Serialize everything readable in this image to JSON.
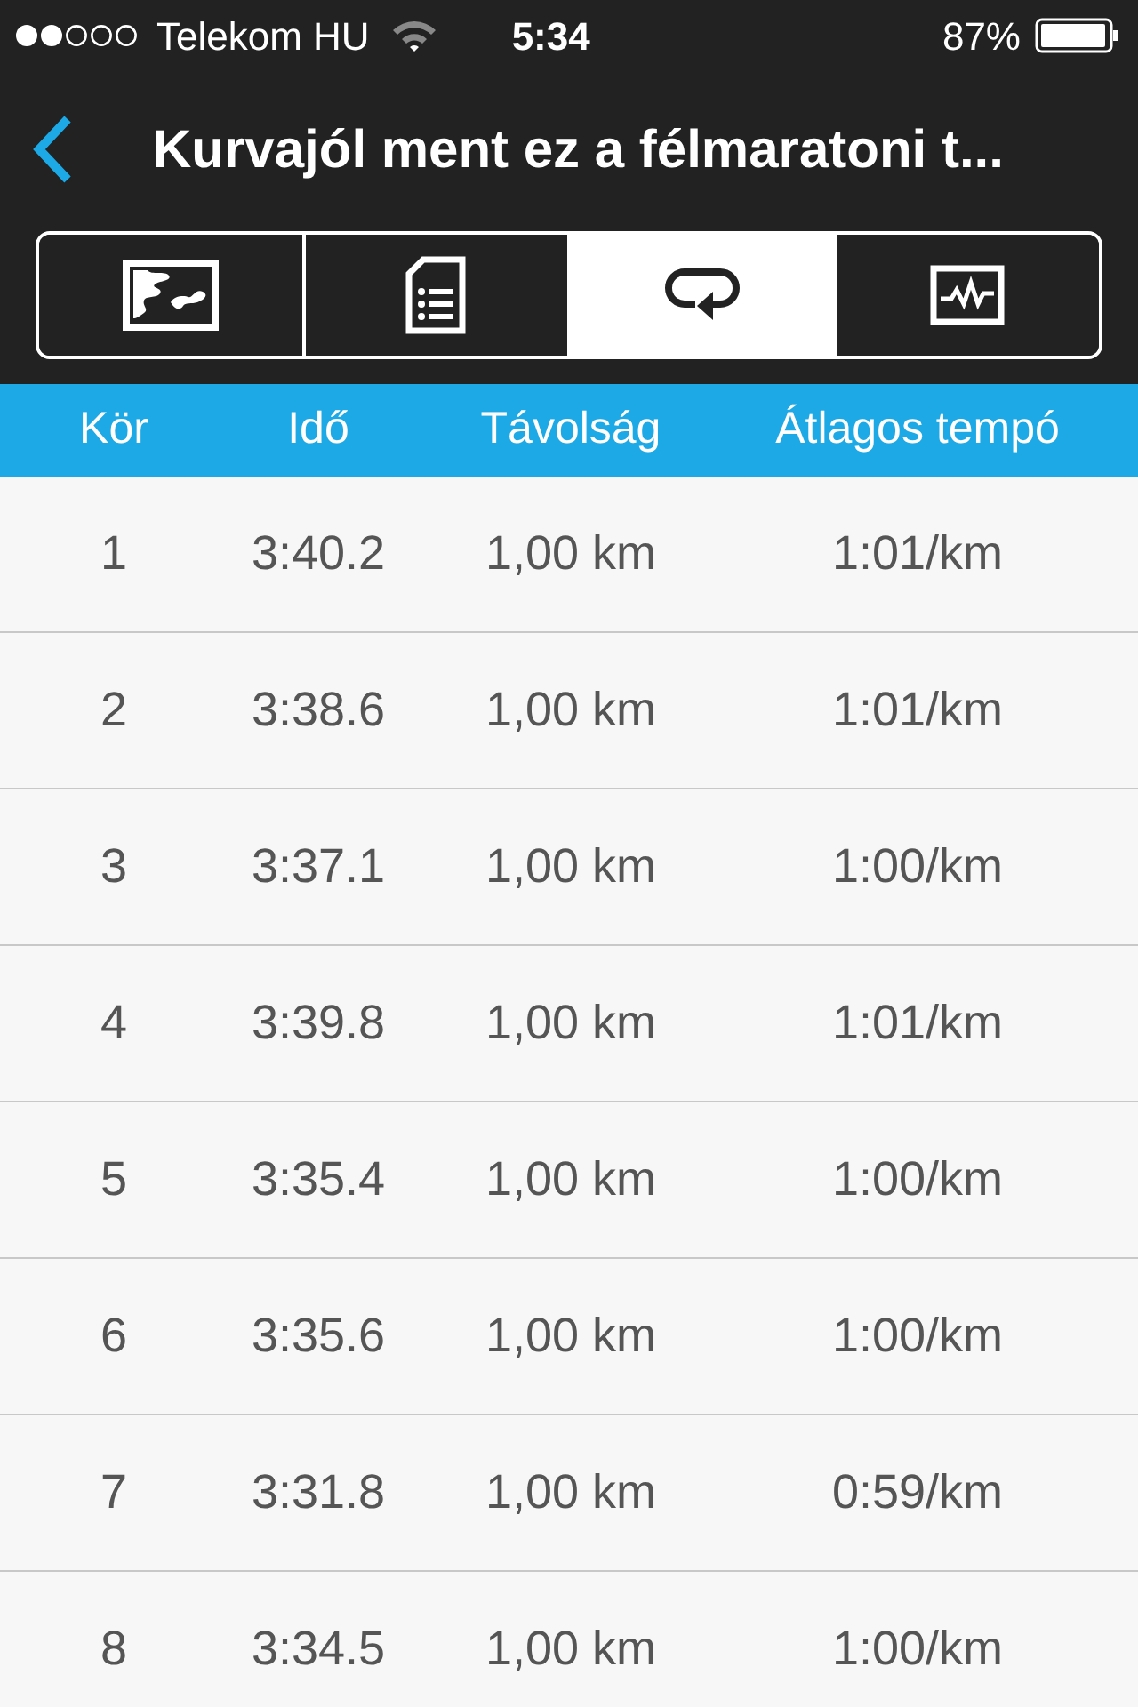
{
  "status_bar": {
    "carrier": "Telekom HU",
    "time": "5:34",
    "battery": "87%"
  },
  "header": {
    "title": "Kurvajól ment ez a félmaratoni t..."
  },
  "tabs": [
    {
      "kind": "map",
      "selected": false
    },
    {
      "kind": "details",
      "selected": false
    },
    {
      "kind": "laps",
      "selected": true
    },
    {
      "kind": "chart",
      "selected": false
    }
  ],
  "table": {
    "columns": [
      "Kör",
      "Idő",
      "Távolság",
      "Átlagos tempó"
    ],
    "rows": [
      [
        "1",
        "3:40.2",
        "1,00 km",
        "1:01/km"
      ],
      [
        "2",
        "3:38.6",
        "1,00 km",
        "1:01/km"
      ],
      [
        "3",
        "3:37.1",
        "1,00 km",
        "1:00/km"
      ],
      [
        "4",
        "3:39.8",
        "1,00 km",
        "1:01/km"
      ],
      [
        "5",
        "3:35.4",
        "1,00 km",
        "1:00/km"
      ],
      [
        "6",
        "3:35.6",
        "1,00 km",
        "1:00/km"
      ],
      [
        "7",
        "3:31.8",
        "1,00 km",
        "0:59/km"
      ],
      [
        "8",
        "3:34.5",
        "1,00 km",
        "1:00/km"
      ]
    ]
  }
}
